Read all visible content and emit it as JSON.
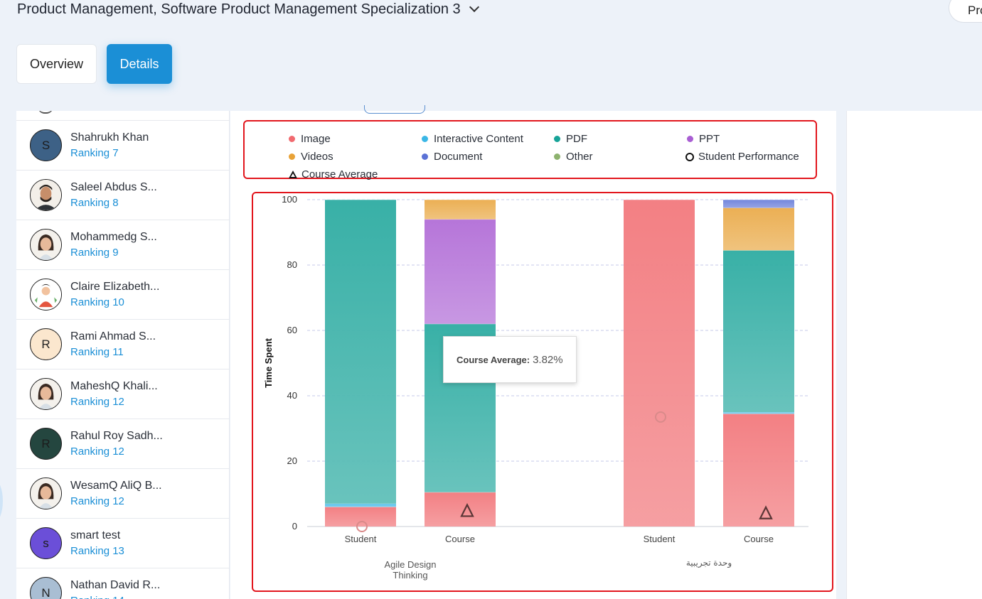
{
  "header": {
    "course_title": "Product Management, Software Product Management Specialization 3",
    "top_right_button": "Pro"
  },
  "tabs": [
    {
      "label": "Overview",
      "active": false
    },
    {
      "label": "Details",
      "active": true
    }
  ],
  "students": [
    {
      "name": "Shahrukh Khan",
      "ranking": "Ranking 7",
      "avatar": {
        "type": "initial",
        "letter": "S",
        "color": "#3d6186"
      }
    },
    {
      "name": "Saleel Abdus S...",
      "ranking": "Ranking 8",
      "avatar": {
        "type": "photo",
        "icon": "man-photo-avatar"
      }
    },
    {
      "name": "Mohammedg S...",
      "ranking": "Ranking 9",
      "avatar": {
        "type": "photo",
        "icon": "woman-photo-avatar"
      }
    },
    {
      "name": "Claire Elizabeth...",
      "ranking": "Ranking 10",
      "avatar": {
        "type": "photo",
        "icon": "illustrated-avatar"
      }
    },
    {
      "name": "Rami Ahmad S...",
      "ranking": "Ranking 11",
      "avatar": {
        "type": "initial",
        "letter": "R",
        "color": "#fbe7ce"
      }
    },
    {
      "name": "MaheshQ Khali...",
      "ranking": "Ranking 12",
      "avatar": {
        "type": "photo",
        "icon": "woman-photo-avatar"
      }
    },
    {
      "name": "Rahul Roy Sadh...",
      "ranking": "Ranking 12",
      "avatar": {
        "type": "initial",
        "letter": "R",
        "color": "#24463f"
      }
    },
    {
      "name": "WesamQ AliQ B...",
      "ranking": "Ranking 12",
      "avatar": {
        "type": "photo",
        "icon": "woman-photo-avatar"
      }
    },
    {
      "name": "smart test",
      "ranking": "Ranking 13",
      "avatar": {
        "type": "initial",
        "letter": "s",
        "color": "#6b4fd8"
      }
    },
    {
      "name": "Nathan David R...",
      "ranking": "Ranking 14",
      "avatar": {
        "type": "initial",
        "letter": "N",
        "color": "#a9bed3"
      }
    }
  ],
  "legend": [
    {
      "label": "Image",
      "color": "#f16a6f",
      "marker": "dot"
    },
    {
      "label": "Interactive Content",
      "color": "#3bb7e6",
      "marker": "dot"
    },
    {
      "label": "PDF",
      "color": "#17a398",
      "marker": "dot"
    },
    {
      "label": "PPT",
      "color": "#a95ed3",
      "marker": "dot"
    },
    {
      "label": "Videos",
      "color": "#e8a237",
      "marker": "dot"
    },
    {
      "label": "Document",
      "color": "#5b72d6",
      "marker": "dot"
    },
    {
      "label": "Other",
      "color": "#8db26e",
      "marker": "dot"
    },
    {
      "label": "Student Performance",
      "color": "#111111",
      "marker": "ring"
    },
    {
      "label": "Course Average",
      "color": "#111111",
      "marker": "triangle"
    }
  ],
  "tooltip": {
    "label": "Course Average:",
    "value": "3.82%"
  },
  "chart_data": {
    "type": "bar",
    "stacked": true,
    "title": "",
    "ylabel": "Time Spent",
    "xlabel": "",
    "ylim": [
      0,
      100
    ],
    "yticks": [
      0,
      20,
      40,
      60,
      80,
      100
    ],
    "grid": true,
    "groups": [
      {
        "label": "Agile Design Thinking",
        "bars": [
          {
            "label": "Student",
            "segments": [
              {
                "series": "Image",
                "value": 6
              },
              {
                "series": "Interactive Content",
                "value": 1
              },
              {
                "series": "PDF",
                "value": 93
              }
            ],
            "student_performance": 0
          },
          {
            "label": "Course",
            "segments": [
              {
                "series": "Image",
                "value": 10.5
              },
              {
                "series": "PDF",
                "value": 51.5
              },
              {
                "series": "PPT",
                "value": 32
              },
              {
                "series": "Videos",
                "value": 6
              }
            ],
            "course_average": 3.82
          }
        ]
      },
      {
        "label": "وحدة تجريبية",
        "bars": [
          {
            "label": "Student",
            "segments": [
              {
                "series": "Image",
                "value": 100
              }
            ],
            "student_performance": 33.5
          },
          {
            "label": "Course",
            "segments": [
              {
                "series": "Image",
                "value": 34.5
              },
              {
                "series": "Interactive Content",
                "value": 0.5
              },
              {
                "series": "PDF",
                "value": 49.5
              },
              {
                "series": "Videos",
                "value": 13
              },
              {
                "series": "Document",
                "value": 2.5
              }
            ],
            "course_average": 3.1
          }
        ]
      }
    ]
  }
}
